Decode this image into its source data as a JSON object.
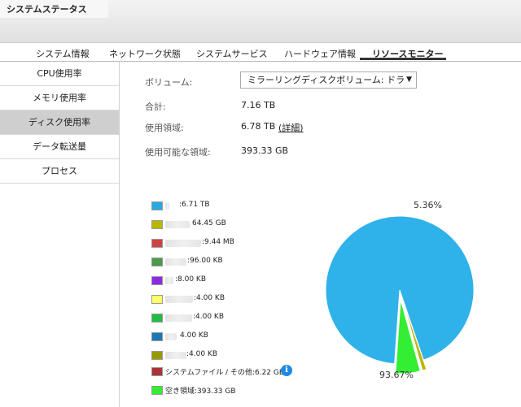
{
  "window": {
    "title": "システムステータス"
  },
  "tabs": [
    {
      "label": "システム情報",
      "active": false
    },
    {
      "label": "ネットワーク状態",
      "active": false
    },
    {
      "label": "システムサービス",
      "active": false
    },
    {
      "label": "ハードウェア情報",
      "active": false
    },
    {
      "label": "リソースモニター",
      "active": true
    }
  ],
  "sidebar": {
    "items": [
      {
        "label": "CPU使用率",
        "active": false
      },
      {
        "label": "メモリ使用率",
        "active": false
      },
      {
        "label": "ディスク使用率",
        "active": true
      },
      {
        "label": "データ転送量",
        "active": false
      },
      {
        "label": "プロセス",
        "active": false
      }
    ]
  },
  "disk": {
    "volume_label": "ボリューム:",
    "volume_value": "ミラーリングディスクボリューム: ドラ",
    "total_label": "合計:",
    "total_value": "7.16 TB",
    "used_label": "使用領域:",
    "used_value": "6.78 TB",
    "details_link": "(詳細)",
    "free_label": "使用可能な領域:",
    "free_value": "393.33 GB"
  },
  "legend": [
    {
      "text": ":6.71 TB",
      "color": "#29a9e1"
    },
    {
      "text": "64.45 GB",
      "color": "#b8b800"
    },
    {
      "text": ":9.44 MB",
      "color": "#cc4444"
    },
    {
      "text": ":96.00 KB",
      "color": "#4a9a4a"
    },
    {
      "text": ":8.00 KB",
      "color": "#8a2be2"
    },
    {
      "text": ":4.00 KB",
      "color": "#ffff66"
    },
    {
      "text": ":4.00 KB",
      "color": "#22bb44"
    },
    {
      "text": "4.00 KB",
      "color": "#1a78b4"
    },
    {
      "text": ":4.00 KB",
      "color": "#999900"
    },
    {
      "text": "システムファイル / その他:6.22 GB",
      "color": "#aa3333"
    },
    {
      "text": "空き領域:393.33 GB",
      "color": "#33ee33"
    }
  ],
  "info_icon": "i",
  "chart_data": {
    "type": "pie",
    "slices": [
      {
        "value": 93.67,
        "color": "#2fb2ea"
      },
      {
        "value": 0.9,
        "color": "#b8b800"
      },
      {
        "value": 0.07,
        "color": "#aa3333"
      },
      {
        "value": 5.36,
        "color": "#33ee33"
      }
    ],
    "labels": {
      "large": "93.67%",
      "small": "5.36%"
    }
  }
}
